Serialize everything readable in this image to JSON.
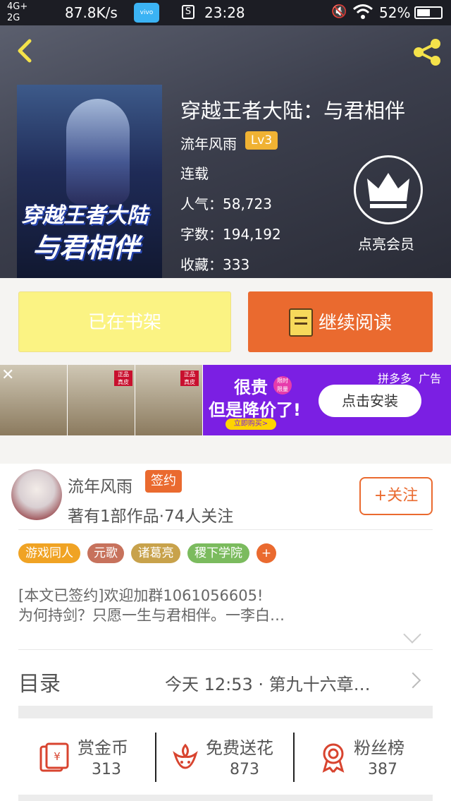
{
  "status_bar": {
    "signal": "4G+\n2G",
    "net_speed": "87.8K/s",
    "app_icon": "vivo",
    "s_icon": "S",
    "time": "23:28",
    "battery_pct": "52%"
  },
  "book": {
    "cover_title_line1": "穿越王者大陆",
    "cover_title_line2": "与君相伴",
    "title": "穿越王者大陆：与君相伴",
    "author": "流年风雨",
    "level": "Lv3",
    "status": "连载",
    "popularity": "人气：58,723",
    "word_count": "字数：194,192",
    "favorites": "收藏：333",
    "vip_label": "点亮会员"
  },
  "actions": {
    "on_shelf": "已在书架",
    "continue_reading": "继续阅读"
  },
  "ad": {
    "close": "✕",
    "shoe_tags": [
      "正品\n真皮",
      "正品\n真皮"
    ],
    "headline1": "很贵",
    "limit_badge": "限时\n限量",
    "headline2": "但是降价了!",
    "buy_now": "立即购买>",
    "install": "点击安装",
    "source": "拼多多  广告"
  },
  "author_card": {
    "name": "流年风雨",
    "badge": "签约",
    "summary": "著有1部作品·74人关注",
    "follow": "+关注"
  },
  "tags": [
    {
      "label": "游戏同人",
      "color": "#f0a324"
    },
    {
      "label": "元歌",
      "color": "#c7725c"
    },
    {
      "label": "诸葛亮",
      "color": "#c8a24b"
    },
    {
      "label": "稷下学院",
      "color": "#7bbb5e"
    },
    {
      "label": "+",
      "color": "#ea6a2f"
    }
  ],
  "intro": {
    "line1": "[本文已签约]欢迎加群1061056605!",
    "line2": "为何持剑？只愿一生与君相伴。一李白…"
  },
  "toc": {
    "label": "目录",
    "latest": "今天 12:53 · 第九十六章…"
  },
  "stats": [
    {
      "name": "赏金币",
      "value": "313",
      "icon": "red-envelope-icon"
    },
    {
      "name": "免费送花",
      "value": "873",
      "icon": "flower-icon"
    },
    {
      "name": "粉丝榜",
      "value": "387",
      "icon": "medal-icon"
    }
  ],
  "colors": {
    "accent": "#ea6a2f",
    "shelf_button": "#fbf383",
    "lv_badge": "#f0b233",
    "ad_bg": "#7b1fe3"
  }
}
